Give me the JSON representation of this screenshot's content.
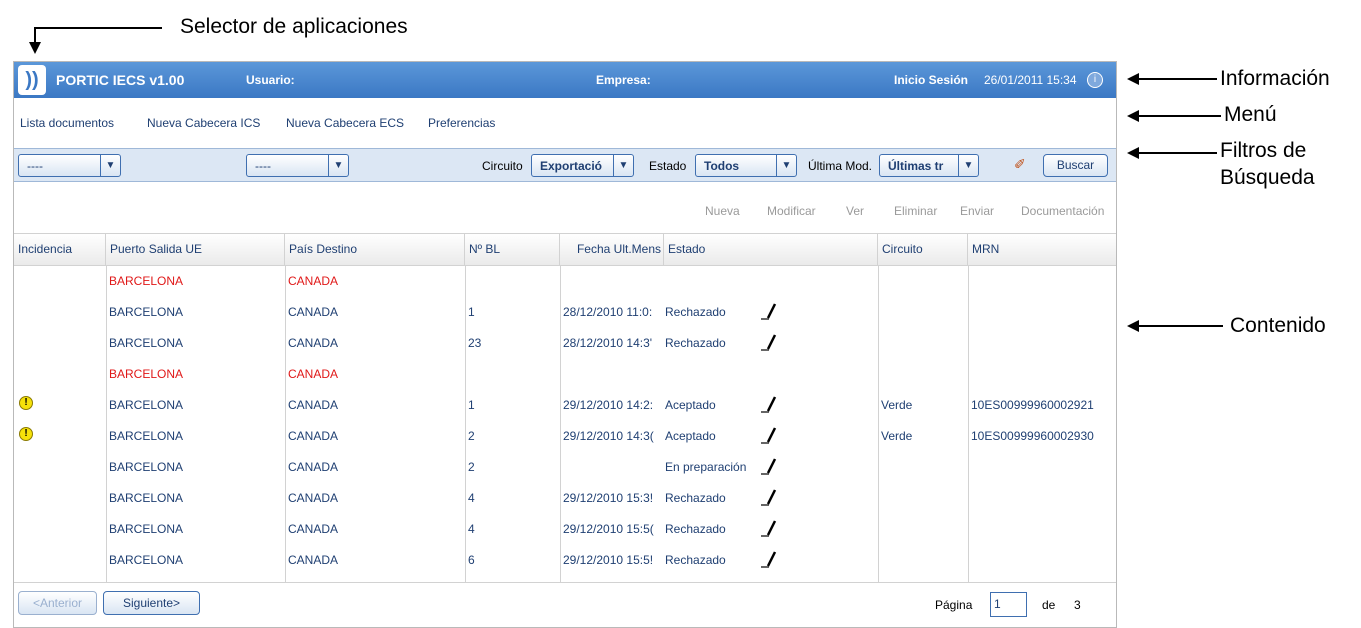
{
  "annotations": {
    "selector": "Selector de aplicaciones",
    "informacion": "Información",
    "menu": "Menú",
    "filtros_line1": "Filtros de",
    "filtros_line2": "Búsqueda",
    "contenido": "Contenido"
  },
  "header": {
    "logo_glyph": "))",
    "app_title": "PORTIC IECS v1.00",
    "usuario_label": "Usuario:",
    "empresa_label": "Empresa:",
    "session_label": "Inicio Sesión",
    "session_value": "26/01/2011 15:34",
    "info_glyph": "i"
  },
  "menu": {
    "items": [
      "Lista documentos",
      "Nueva Cabecera ICS",
      "Nueva Cabecera ECS",
      "Preferencias"
    ]
  },
  "filters": {
    "select1": "----",
    "select2": "----",
    "circuito_label": "Circuito",
    "circuito_value": "Exportació",
    "estado_label": "Estado",
    "estado_value": "Todos",
    "ultima_label": "Última Mod.",
    "ultima_value": "Últimas tr",
    "arrow_glyph": "▼",
    "eraser_glyph": "✐",
    "search_button": "Buscar"
  },
  "actions": {
    "items": [
      "Nueva",
      "Modificar",
      "Ver",
      "Eliminar",
      "Enviar",
      "Documentación"
    ]
  },
  "table": {
    "columns": [
      "Incidencia",
      "Puerto Salida UE",
      "País Destino",
      "Nº BL",
      "Fecha Ult.Mens",
      "Estado",
      "Circuito",
      "MRN"
    ],
    "rows": [
      {
        "warn": false,
        "red": true,
        "puerto": "BARCELONA",
        "pais": "CANADA",
        "bl": "",
        "fecha": "",
        "estado": "",
        "edit": false,
        "circuito": "",
        "mrn": ""
      },
      {
        "warn": false,
        "red": false,
        "puerto": "BARCELONA",
        "pais": "CANADA",
        "bl": "1",
        "fecha": "28/12/2010 11:0:",
        "estado": "Rechazado",
        "edit": true,
        "circuito": "",
        "mrn": ""
      },
      {
        "warn": false,
        "red": false,
        "puerto": "BARCELONA",
        "pais": "CANADA",
        "bl": "23",
        "fecha": "28/12/2010 14:3'",
        "estado": "Rechazado",
        "edit": true,
        "circuito": "",
        "mrn": ""
      },
      {
        "warn": false,
        "red": true,
        "puerto": "BARCELONA",
        "pais": "CANADA",
        "bl": "",
        "fecha": "",
        "estado": "",
        "edit": false,
        "circuito": "",
        "mrn": ""
      },
      {
        "warn": true,
        "red": false,
        "puerto": "BARCELONA",
        "pais": "CANADA",
        "bl": "1",
        "fecha": "29/12/2010 14:2:",
        "estado": "Aceptado",
        "edit": true,
        "circuito": "Verde",
        "mrn": "10ES00999960002921"
      },
      {
        "warn": true,
        "red": false,
        "puerto": "BARCELONA",
        "pais": "CANADA",
        "bl": "2",
        "fecha": "29/12/2010 14:3(",
        "estado": "Aceptado",
        "edit": true,
        "circuito": "Verde",
        "mrn": "10ES00999960002930"
      },
      {
        "warn": false,
        "red": false,
        "puerto": "BARCELONA",
        "pais": "CANADA",
        "bl": "2",
        "fecha": "",
        "estado": "En preparación",
        "edit": true,
        "circuito": "",
        "mrn": ""
      },
      {
        "warn": false,
        "red": false,
        "puerto": "BARCELONA",
        "pais": "CANADA",
        "bl": "4",
        "fecha": "29/12/2010 15:3!",
        "estado": "Rechazado",
        "edit": true,
        "circuito": "",
        "mrn": ""
      },
      {
        "warn": false,
        "red": false,
        "puerto": "BARCELONA",
        "pais": "CANADA",
        "bl": "4",
        "fecha": "29/12/2010 15:5(",
        "estado": "Rechazado",
        "edit": true,
        "circuito": "",
        "mrn": ""
      },
      {
        "warn": false,
        "red": false,
        "puerto": "BARCELONA",
        "pais": "CANADA",
        "bl": "6",
        "fecha": "29/12/2010 15:5!",
        "estado": "Rechazado",
        "edit": true,
        "circuito": "",
        "mrn": ""
      }
    ]
  },
  "pager": {
    "prev": "<Anterior",
    "next": "Siguiente>",
    "page_label": "Página",
    "page_value": "1",
    "of_label": "de",
    "total_pages": "3"
  },
  "colors": {
    "header_blue": "#3b78c4",
    "link_blue": "#1f3f72",
    "error_red": "#e01818",
    "filter_bg": "#dce7f4"
  }
}
